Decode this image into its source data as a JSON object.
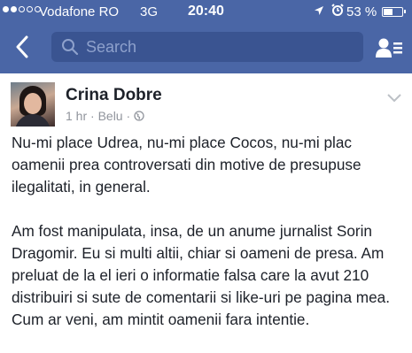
{
  "status_bar": {
    "carrier": "Vodafone RO",
    "network": "3G",
    "time": "20:40",
    "battery_percent": "53 %",
    "battery_level": 0.53,
    "signal_bars_filled": 2,
    "signal_bars_total": 5,
    "icons": [
      "location-arrow-icon",
      "alarm-icon",
      "battery-icon"
    ]
  },
  "navbar": {
    "search_placeholder": "Search",
    "icons": [
      "back-chevron-icon",
      "search-icon",
      "friend-requests-icon"
    ],
    "background_color": "#4a66a6"
  },
  "post": {
    "author": "Crina Dobre",
    "meta": "1 hr · Belu ·",
    "icons": [
      "globe-icon",
      "chevron-down-icon"
    ],
    "paragraphs": [
      "Nu-mi place Udrea, nu-mi place Cocos, nu-mi plac oamenii prea controversati din motive de presupuse ilegalitati, in general.",
      "Am fost manipulata, insa, de un anume jurnalist Sorin Dragomir. Eu si multi altii, chiar si oameni de presa. Am preluat de la el ieri o informatie falsa care la avut 210 distribuiri si sute de comentarii si like-uri pe pagina mea. Cum ar veni, am mintit oamenii fara intentie."
    ]
  }
}
